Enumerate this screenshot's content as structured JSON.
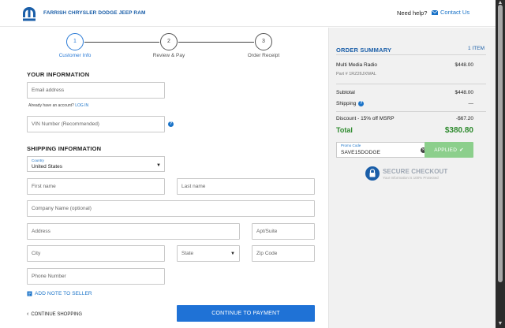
{
  "header": {
    "brand": "FARRISH CHRYSLER DODGE JEEP RAM",
    "help_text": "Need help?",
    "contact_label": "Contact Us"
  },
  "steps": [
    {
      "number": "1",
      "label": "Customer Info",
      "active": true
    },
    {
      "number": "2",
      "label": "Review & Pay",
      "active": false
    },
    {
      "number": "3",
      "label": "Order Receipt",
      "active": false
    }
  ],
  "your_info": {
    "title": "YOUR INFORMATION",
    "email_placeholder": "Email address",
    "account_text": "Already have an account?",
    "login_link": "LOG IN",
    "vin_placeholder": "VIN Number (Recommended)"
  },
  "shipping": {
    "title": "SHIPPING INFORMATION",
    "country_label": "Country",
    "country_value": "United States",
    "first_name": "First name",
    "last_name": "Last name",
    "company": "Company Name (optional)",
    "address": "Address",
    "apt": "Apt/Suite",
    "city": "City",
    "state": "State",
    "zip": "Zip Code",
    "phone": "Phone Number",
    "add_note": "ADD NOTE TO SELLER"
  },
  "actions": {
    "continue_shopping": "CONTINUE SHOPPING",
    "continue_payment": "CONTINUE TO PAYMENT"
  },
  "summary": {
    "title": "ORDER SUMMARY",
    "item_count": "1 ITEM",
    "item_name": "Multi Media Radio",
    "item_price": "$448.00",
    "item_part": "Part # 1RZ26JXWAL",
    "subtotal_label": "Subtotal",
    "subtotal_value": "$448.00",
    "shipping_label": "Shipping",
    "shipping_value": "—",
    "discount_label": "Discount - 15% off MSRP",
    "discount_value": "-$67.20",
    "total_label": "Total",
    "total_value": "$380.80",
    "promo_label": "Promo Code",
    "promo_value": "SAVE15DODGE",
    "applied_label": "APPLIED",
    "secure_title": "SECURE CHECKOUT",
    "secure_sub": "Your Information is 100% Protected"
  },
  "colors": {
    "brand_blue": "#1a5ea8",
    "link_blue": "#1a73c8",
    "total_green": "#2d8a2d",
    "applied_green": "#8ccf8c"
  }
}
